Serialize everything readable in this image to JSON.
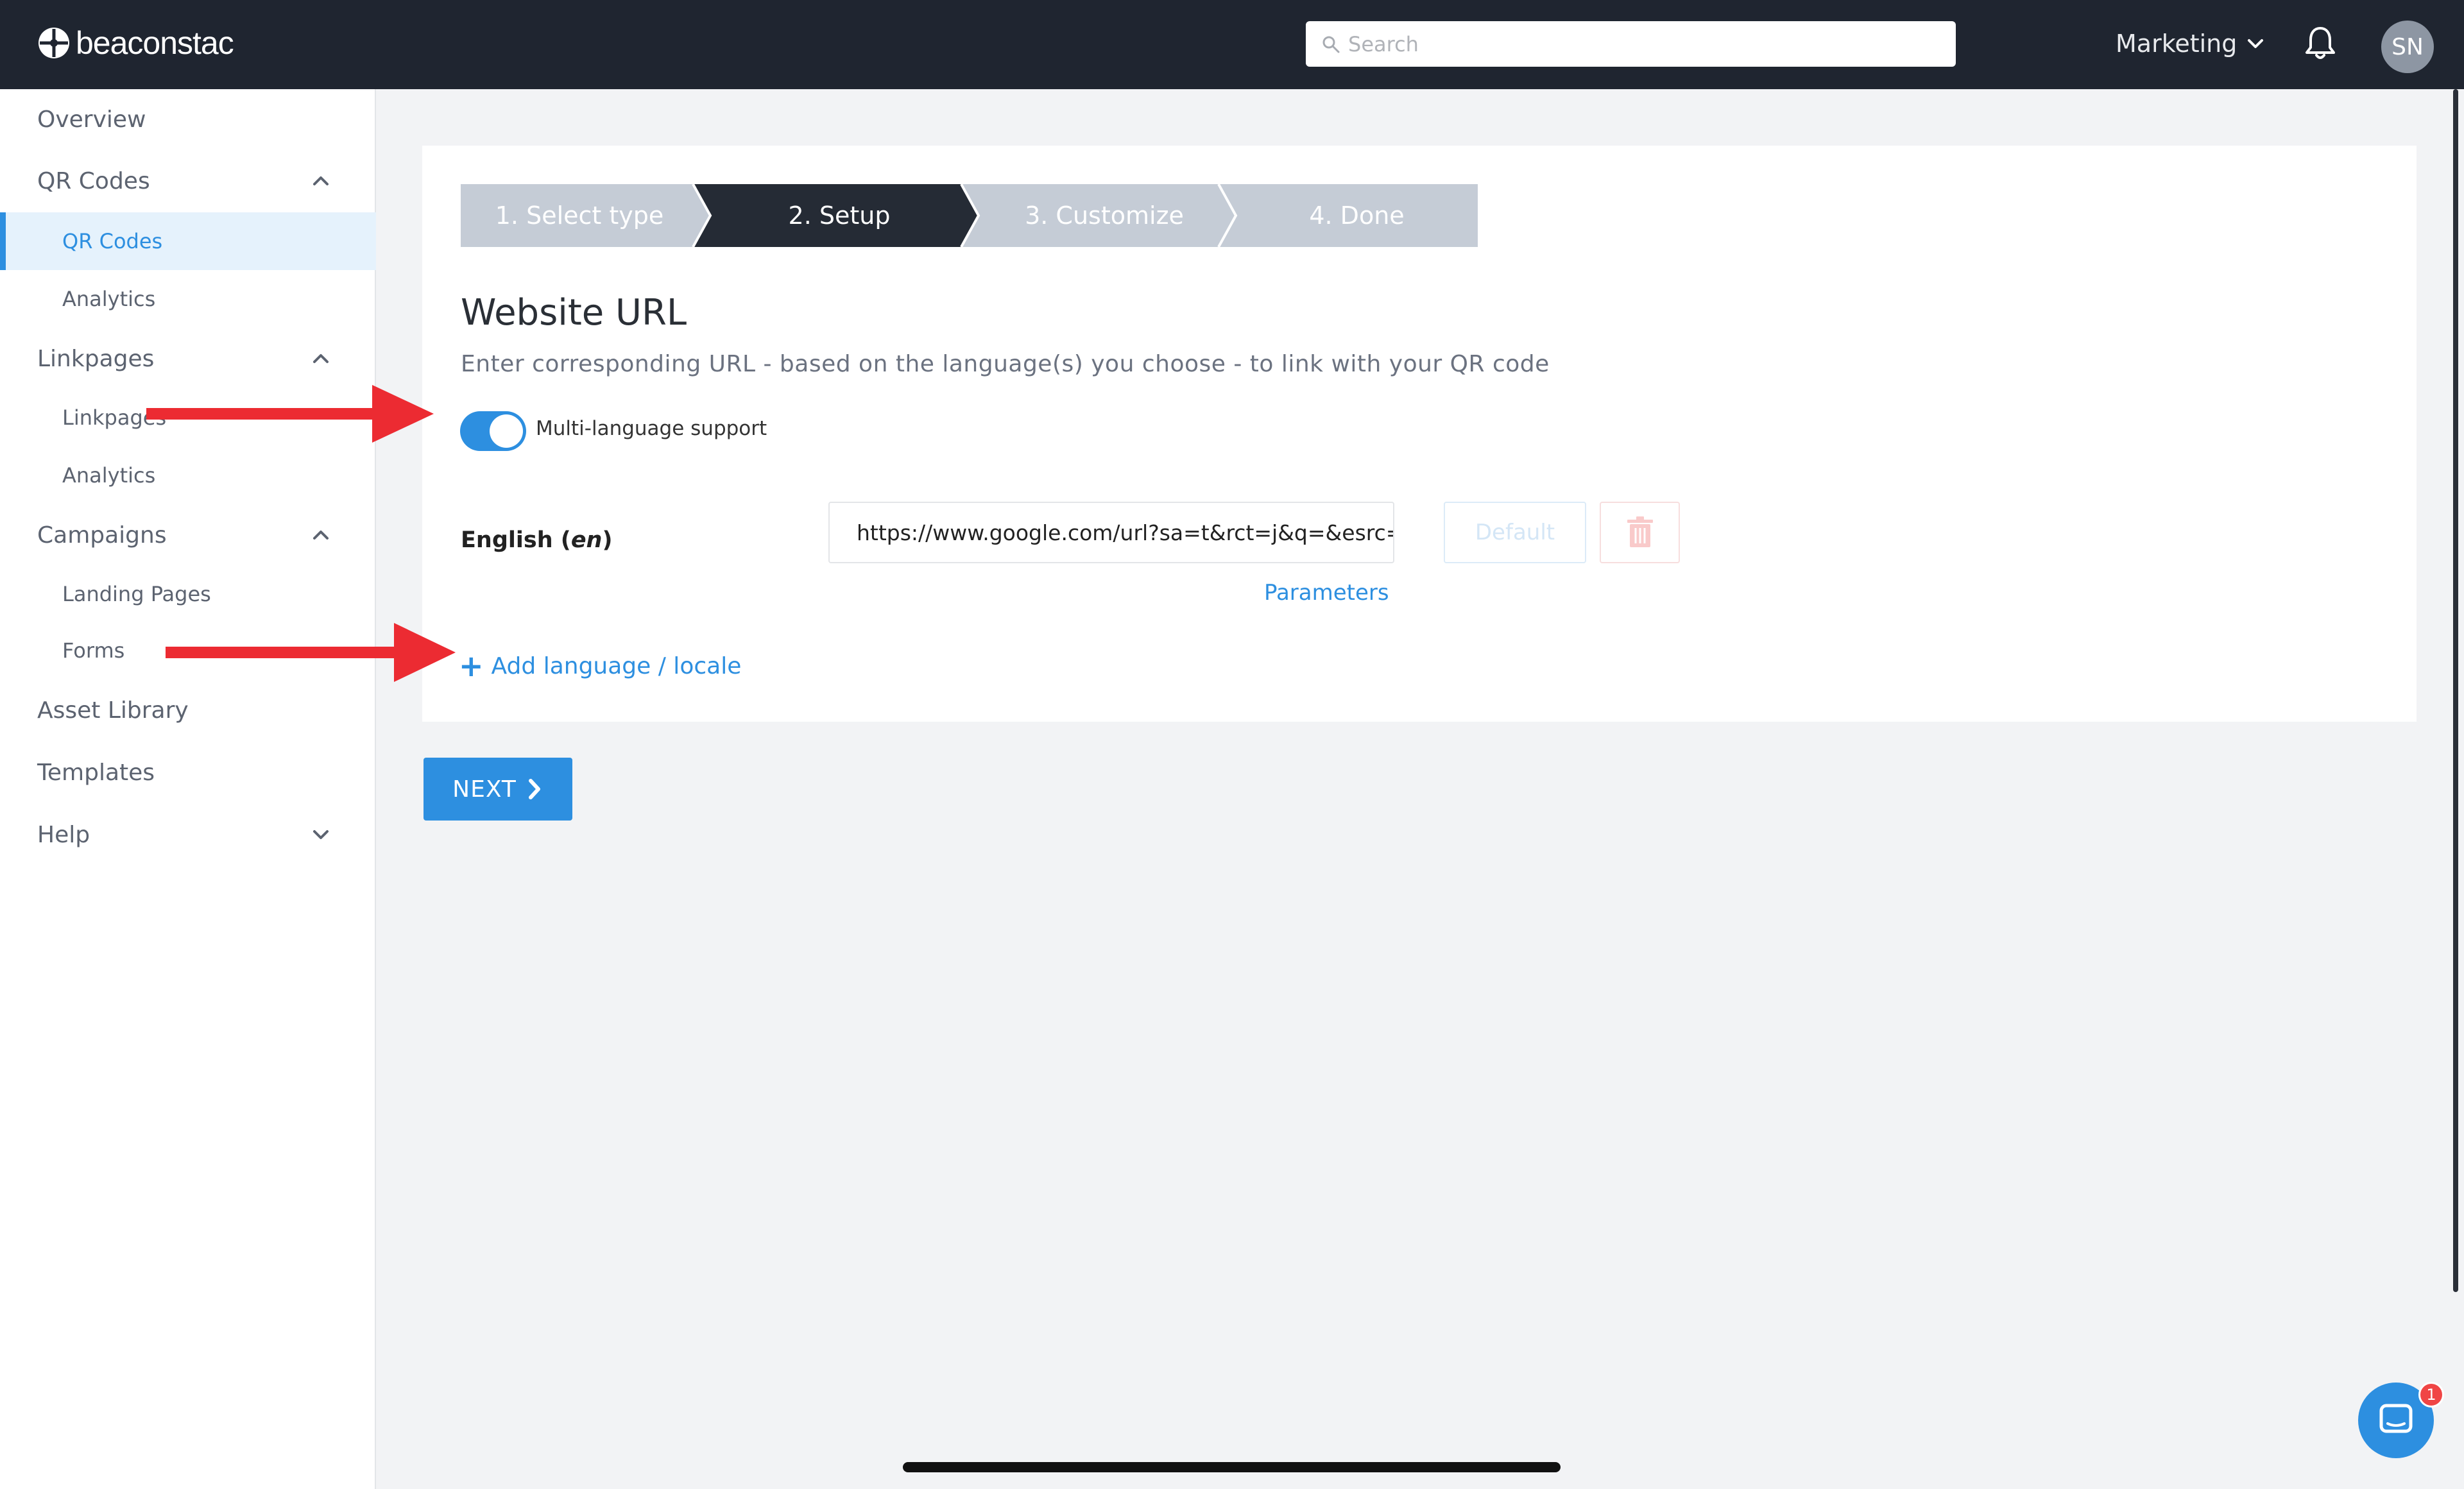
{
  "header": {
    "logo_text": "beaconstac",
    "search_placeholder": "Search",
    "workspace_label": "Marketing",
    "avatar_initials": "SN"
  },
  "sidebar": {
    "items": [
      {
        "label": "Overview"
      },
      {
        "label": "QR Codes"
      },
      {
        "label": "QR Codes"
      },
      {
        "label": "Analytics"
      },
      {
        "label": "Linkpages"
      },
      {
        "label": "Linkpages"
      },
      {
        "label": "Analytics"
      },
      {
        "label": "Campaigns"
      },
      {
        "label": "Landing Pages"
      },
      {
        "label": "Forms"
      },
      {
        "label": "Asset Library"
      },
      {
        "label": "Templates"
      },
      {
        "label": "Help"
      }
    ],
    "active_item": "QR Codes"
  },
  "stepper": {
    "steps": [
      {
        "label": "1. Select type",
        "state": "completed"
      },
      {
        "label": "2. Setup",
        "state": "active"
      },
      {
        "label": "3. Customize",
        "state": "pending"
      },
      {
        "label": "4. Done",
        "state": "pending"
      }
    ]
  },
  "form": {
    "title": "Website URL",
    "subtitle": "Enter corresponding URL - based on the language(s) you choose - to link with your QR code",
    "toggle_label": "Multi-language support",
    "toggle_on": true,
    "language_name": "English (",
    "language_code": "en",
    "language_close": ")",
    "url_value": "https://www.google.com/url?sa=t&rct=j&q=&esrc=s",
    "default_label": "Default",
    "parameters_label": "Parameters",
    "add_language_label": "Add language / locale"
  },
  "footer": {
    "next_label": "NEXT",
    "chat_badge_count": "1"
  },
  "colors": {
    "accent": "#2d8fe0",
    "topbar": "#1f2530",
    "annotation_arrow": "#ec2b32"
  }
}
